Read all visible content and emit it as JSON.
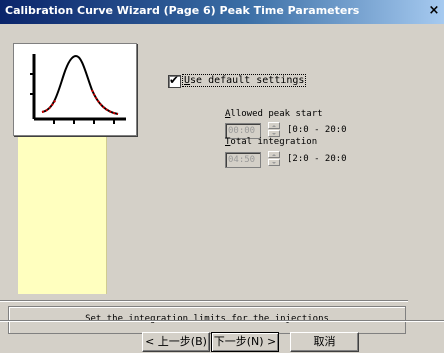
{
  "window": {
    "title": "Calibration Curve Wizard (Page 6) Peak Time Parameters",
    "close_glyph": "×"
  },
  "icons": {
    "graph": "peak-graph-icon",
    "close": "close-icon",
    "checkmark": "checkmark-icon",
    "spin_up": "spin-up-arrow-icon",
    "spin_down": "spin-down-arrow-icon"
  },
  "colors": {
    "title_bar_start": "#0a246a",
    "title_bar_end": "#a6caf0",
    "face": "#d4d0c8",
    "side_panel": "#ffffbf",
    "curve": "#000000",
    "curve_highlight": "#cc0000"
  },
  "default_settings": {
    "checked": true,
    "check_glyph": "✔",
    "label_first": "U",
    "label_rest": "se default settings"
  },
  "allowed_peak_start": {
    "label_first": "A",
    "label_rest": "llowed peak start",
    "value": "00:00",
    "range": "[0:0 - 20:0"
  },
  "total_integration": {
    "label_first": "T",
    "label_rest": "otal integration",
    "value": "04:50",
    "range": "[2:0 - 20:0"
  },
  "status_text": "Set the integration limits for the injections",
  "buttons": {
    "back": "< 上一步(B)",
    "next": "下一步(N) >",
    "cancel": "取消"
  }
}
